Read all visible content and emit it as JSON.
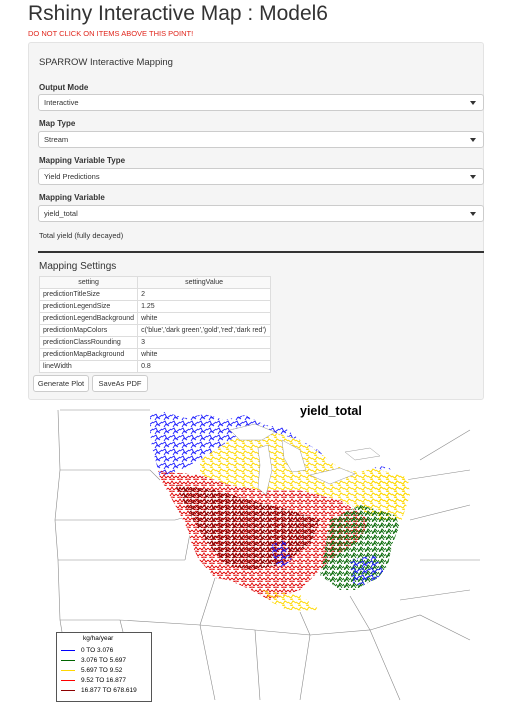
{
  "app": {
    "title": "Rshiny Interactive Map : Model6",
    "warning": "DO NOT CLICK ON ITEMS ABOVE THIS POINT!"
  },
  "panel": {
    "heading": "SPARROW Interactive Mapping",
    "output_mode": {
      "label": "Output Mode",
      "value": "Interactive"
    },
    "map_type": {
      "label": "Map Type",
      "value": "Stream"
    },
    "mapping_variable_type": {
      "label": "Mapping Variable Type",
      "value": "Yield Predictions"
    },
    "mapping_variable": {
      "label": "Mapping Variable",
      "value": "yield_total"
    },
    "help_text": "Total yield (fully decayed)"
  },
  "settings": {
    "title": "Mapping Settings",
    "columns": [
      "setting",
      "settingValue"
    ],
    "rows": [
      [
        "predictionTitleSize",
        "2"
      ],
      [
        "predictionLegendSize",
        "1.25"
      ],
      [
        "predictionLegendBackground",
        "white"
      ],
      [
        "predictionMapColors",
        "c('blue','dark green','gold','red','dark red')"
      ],
      [
        "predictionClassRounding",
        "3"
      ],
      [
        "predictionMapBackground",
        "white"
      ],
      [
        "lineWidth",
        "0.8"
      ]
    ]
  },
  "buttons": {
    "generate": "Generate Plot",
    "save_pdf": "SaveAs PDF"
  },
  "map": {
    "title": "yield_total",
    "legend_title": "kg/ha/year",
    "legend": [
      {
        "label": "0 TO 3.076",
        "color": "#0000ff"
      },
      {
        "label": "3.076 TO 5.697",
        "color": "#006400"
      },
      {
        "label": "5.697 TO 9.52",
        "color": "#ffd700"
      },
      {
        "label": "9.52 TO 16.877",
        "color": "#ff0000"
      },
      {
        "label": "16.877 TO 678.619",
        "color": "#8b0000"
      }
    ]
  }
}
